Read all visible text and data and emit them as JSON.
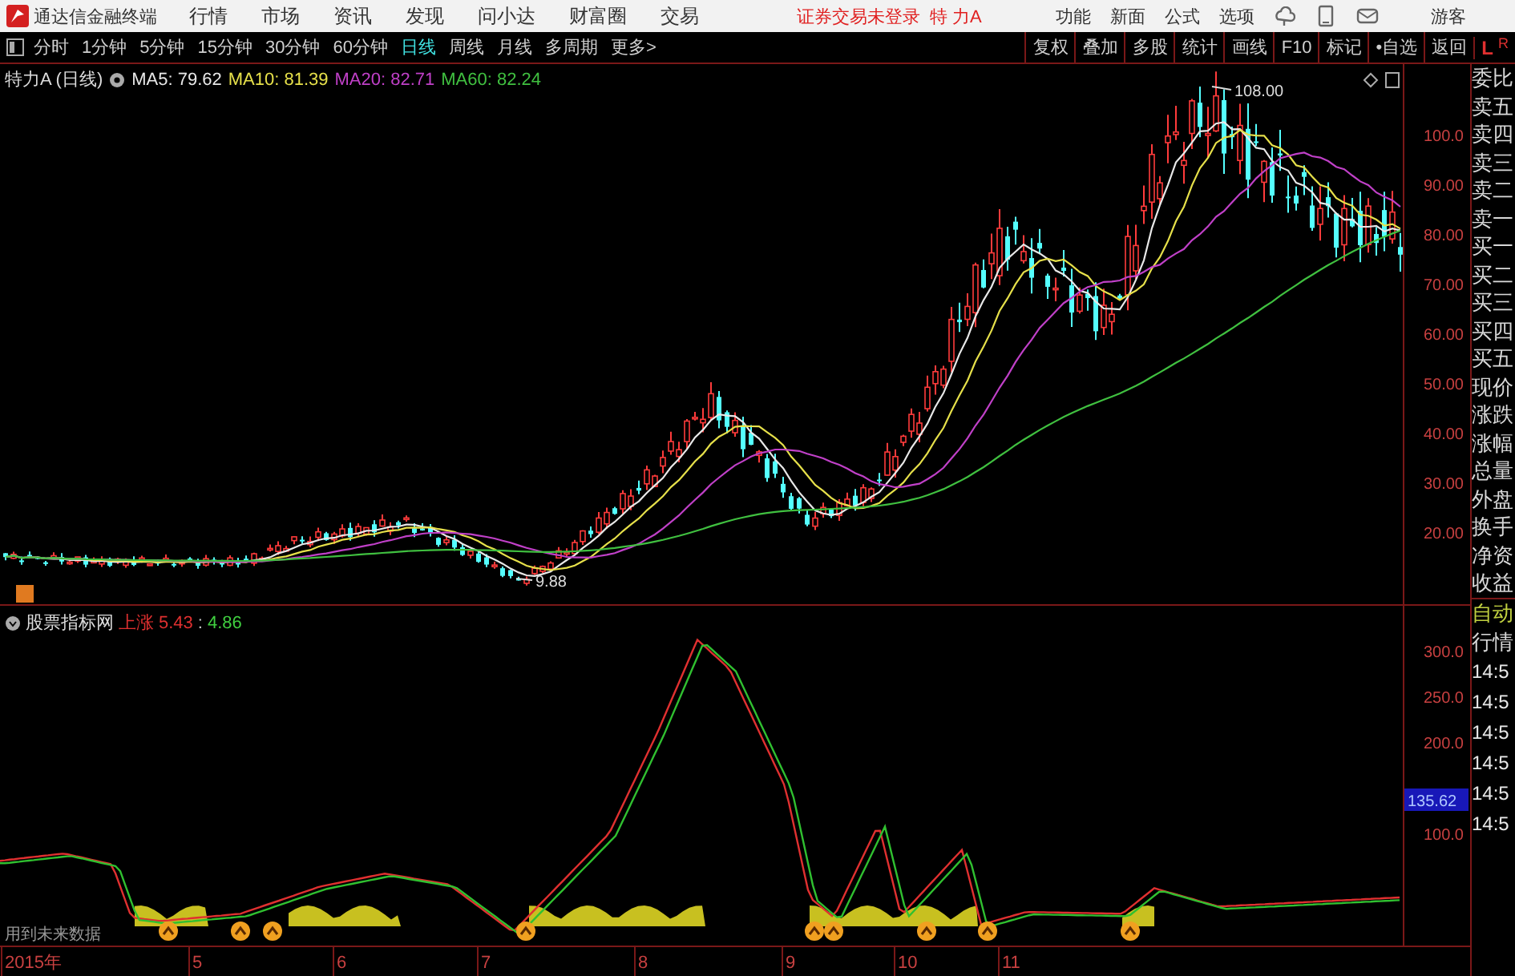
{
  "menu_bar": {
    "app_name": "通达信金融终端",
    "menus": [
      "行情",
      "市场",
      "资讯",
      "发现",
      "问小达",
      "财富圈",
      "交易"
    ],
    "status": "证券交易未登录",
    "stock": "特 力A",
    "right_menus": [
      "功能",
      "新面",
      "公式",
      "选项"
    ],
    "user": "游客"
  },
  "period_tabs": [
    {
      "label": "分时",
      "selected": false
    },
    {
      "label": "1分钟",
      "selected": false
    },
    {
      "label": "5分钟",
      "selected": false
    },
    {
      "label": "15分钟",
      "selected": false
    },
    {
      "label": "30分钟",
      "selected": false
    },
    {
      "label": "60分钟",
      "selected": false
    },
    {
      "label": "日线",
      "selected": true
    },
    {
      "label": "周线",
      "selected": false
    },
    {
      "label": "月线",
      "selected": false
    },
    {
      "label": "多周期",
      "selected": false
    },
    {
      "label": "更多>",
      "selected": false
    }
  ],
  "tool_buttons": [
    "复权",
    "叠加",
    "多股",
    "统计",
    "画线",
    "F10",
    "标记",
    "•自选",
    "返回"
  ],
  "corner": {
    "left": "L",
    "right": "R"
  },
  "price_chart": {
    "title": "特力A (日线)",
    "ma": [
      {
        "label": "MA5: 79.62",
        "color": "#e8e8e8"
      },
      {
        "label": "MA10: 81.39",
        "color": "#e6e04a"
      },
      {
        "label": "MA20: 82.71",
        "color": "#c040c8"
      },
      {
        "label": "MA60: 82.24",
        "color": "#40c040"
      }
    ],
    "high_label": "108.00",
    "low_label": "9.88",
    "y_ticks": [
      "100.0",
      "90.00",
      "80.00",
      "70.00",
      "60.00",
      "50.00",
      "40.00",
      "30.00",
      "20.00"
    ]
  },
  "indicator": {
    "name": "股票指标网",
    "label": "上涨",
    "value_1": "5.43",
    "separator": ":",
    "value_2": "4.86",
    "y_ticks": [
      "300.0",
      "250.0",
      "200.0",
      "100.0"
    ],
    "cursor_value": "135.62",
    "note": "用到未来数据"
  },
  "x_axis": [
    "2015年",
    "5",
    "6",
    "7",
    "8",
    "9",
    "10",
    "11"
  ],
  "side_panel": {
    "labels": [
      "委比",
      "卖五",
      "卖四",
      "卖三",
      "卖二",
      "卖一",
      "买一",
      "买二",
      "买三",
      "买四",
      "买五",
      "现价",
      "涨跌",
      "涨幅",
      "总量",
      "外盘",
      "换手",
      "净资",
      "收益"
    ],
    "mode": [
      "自动",
      "行情"
    ],
    "times": [
      "14:5",
      "14:5",
      "14:5",
      "14:5",
      "14:5",
      "14:5"
    ]
  }
}
